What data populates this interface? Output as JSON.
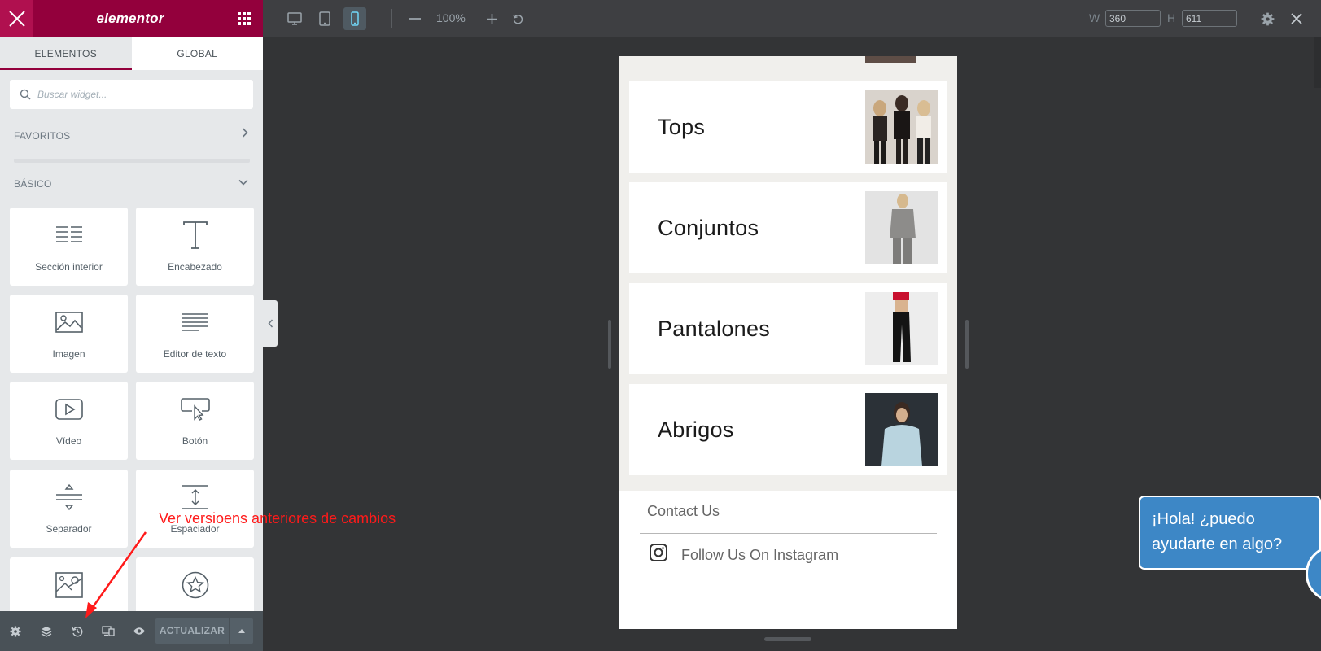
{
  "panel": {
    "logo": "elementor",
    "tabs": [
      {
        "label": "ELEMENTOS",
        "active": true
      },
      {
        "label": "GLOBAL",
        "active": false
      }
    ],
    "search_placeholder": "Buscar widget...",
    "categories": {
      "favorites": "FAVORITOS",
      "basic": "BÁSICO"
    },
    "widgets": [
      {
        "label": "Sección interior",
        "icon": "inner-section-icon"
      },
      {
        "label": "Encabezado",
        "icon": "heading-icon"
      },
      {
        "label": "Imagen",
        "icon": "image-icon"
      },
      {
        "label": "Editor de texto",
        "icon": "text-editor-icon"
      },
      {
        "label": "Vídeo",
        "icon": "video-icon"
      },
      {
        "label": "Botón",
        "icon": "button-icon"
      },
      {
        "label": "Separador",
        "icon": "divider-icon"
      },
      {
        "label": "Espaciador",
        "icon": "spacer-icon"
      },
      {
        "label": "",
        "icon": "google-maps-icon"
      },
      {
        "label": "",
        "icon": "star-icon"
      }
    ],
    "footer": {
      "update_label": "ACTUALIZAR",
      "icons": [
        "settings-icon",
        "navigator-icon",
        "history-icon",
        "responsive-icon",
        "preview-icon"
      ]
    }
  },
  "topbar": {
    "zoom": "100%",
    "width_label": "W",
    "width_value": "360",
    "height_label": "H",
    "height_value": "611",
    "active_device": "mobile"
  },
  "preview": {
    "categories": [
      {
        "title": "Tops",
        "image_color": "#3a2f2b"
      },
      {
        "title": "Conjuntos",
        "image_color": "#8d8c8a"
      },
      {
        "title": "Pantalones",
        "image_color": "#222222"
      },
      {
        "title": "Abrigos",
        "image_color": "#2b3137"
      }
    ],
    "contact": "Contact Us",
    "instagram": "Follow Us On Instagram"
  },
  "chat": {
    "line1": "¡Hola! ¿puedo",
    "line2": "ayudarte en algo?"
  },
  "annotation": {
    "text": "Ver versioens anteriores de cambios",
    "color": "#ff1a1a"
  },
  "colors": {
    "brand": "#93003c",
    "panel_bg": "#e6e8ea",
    "canvas_bg": "#333436",
    "chat": "#3d87c6"
  }
}
